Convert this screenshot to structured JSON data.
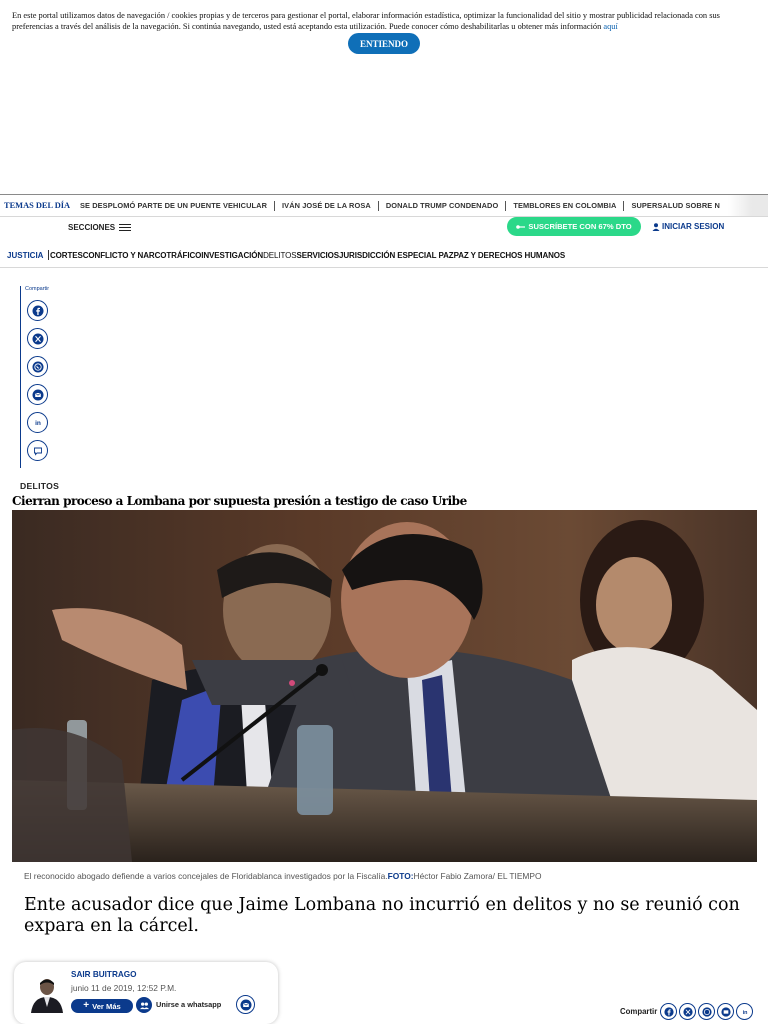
{
  "cookie": {
    "text": "En este portal utilizamos datos de navegación / cookies propias y de terceros para gestionar el portal, elaborar información estadística, optimizar la funcionalidad del sitio y mostrar publicidad relacionada con sus preferencias a través del análisis de la navegación. Si continúa navegando, usted está aceptando esta utilización. Puede conocer cómo deshabilitarlas u obtener más información",
    "link": "aquí",
    "button": "ENTIENDO"
  },
  "trending": {
    "title": "TEMAS DEL DÍA",
    "items": [
      "SE DESPLOMÓ PARTE DE UN PUENTE VEHICULAR",
      "IVÁN JOSÉ DE LA ROSA",
      "DONALD TRUMP CONDENADO",
      "TEMBLORES EN COLOMBIA",
      "SUPERSALUD SOBRE N"
    ]
  },
  "header": {
    "sections": "SECCIONES",
    "subscribe": "SUSCRÍBETE CON 67% DTO",
    "login": "INICIAR SESION"
  },
  "secnav": {
    "title": "JUSTICIA",
    "items": [
      "CORTES",
      "CONFLICTO Y NARCOTRÁFICO",
      "INVESTIGACIÓN",
      "DELITOS",
      "SERVICIOS",
      "JURISDICCIÓN ESPECIAL PAZ",
      "PAZ Y DERECHOS HUMANOS"
    ]
  },
  "share": {
    "label": "Compartir",
    "icons": [
      "facebook-icon",
      "x-icon",
      "whatsapp-icon",
      "email-icon",
      "linkedin-icon",
      "comment-icon"
    ]
  },
  "article": {
    "category": "DELITOS",
    "headline": "Cierran proceso a Lombana por supuesta presión a testigo de caso Uribe",
    "caption": "El reconocido abogado defiende a varios concejales de Floridablanca investigados por la Fiscalía.",
    "photo_label": "FOTO:",
    "photo_credit": "Héctor Fabio Zamora/ EL TIEMPO",
    "dek": "Ente acusador dice que Jaime Lombana no incurrió en delitos y no se reunió con expara en la cárcel."
  },
  "author": {
    "name": "SAIR BUITRAGO",
    "date": "junio 11 de 2019, 12:52 P.M.",
    "ver_mas": "Ver Más",
    "whatsapp": "Unirse a whatsapp"
  },
  "bottom_share": {
    "label": "Compartir"
  },
  "colors": {
    "brand_blue": "#0b3a8c",
    "cookie_button": "#0f6fb8",
    "subscribe_green": "#2bd889"
  }
}
